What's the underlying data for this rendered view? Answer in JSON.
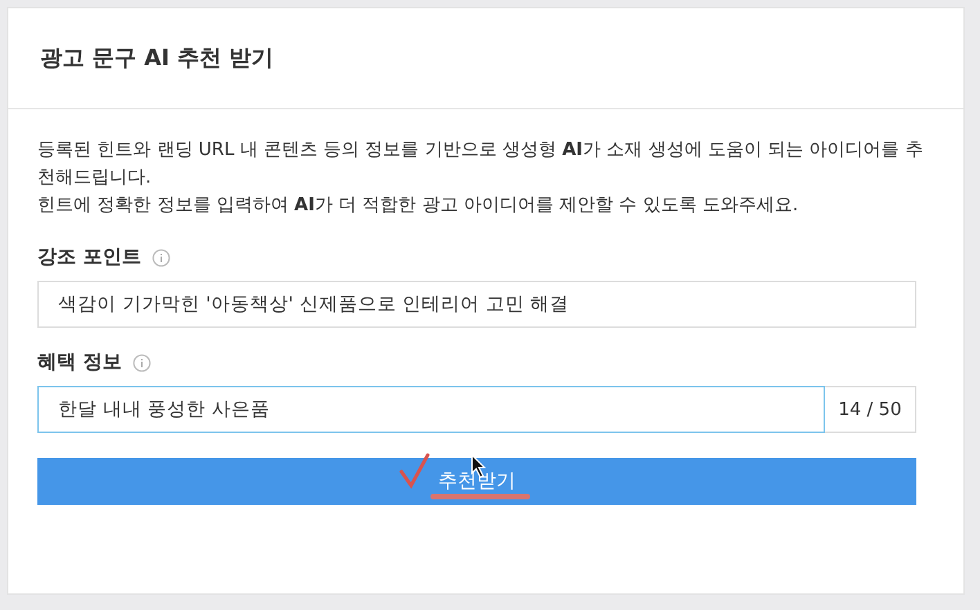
{
  "panel": {
    "title": "광고 문구 AI 추천 받기"
  },
  "description": [
    "등록된 힌트와 랜딩 URL 내 콘텐츠 등의 정보를 기반으로 생성형 **AI**가 소재 생성에 도움이 되는 아이디어를 추천해드립니다.",
    "힌트에 정확한 정보를 입력하여 **AI**가 더 적합한 광고 아이디어를 제안할 수 있도록 도와주세요."
  ],
  "fields": [
    {
      "label": "강조 포인트",
      "value": "색감이 기가막힌 '아동책상' 신제품으로 인테리어 고민 해결",
      "focused": false
    },
    {
      "label": "혜택 정보",
      "value": "한달 내내 풍성한 사은품",
      "counter": "14 / 50",
      "focused": true
    }
  ],
  "button": {
    "label": "추천받기"
  }
}
